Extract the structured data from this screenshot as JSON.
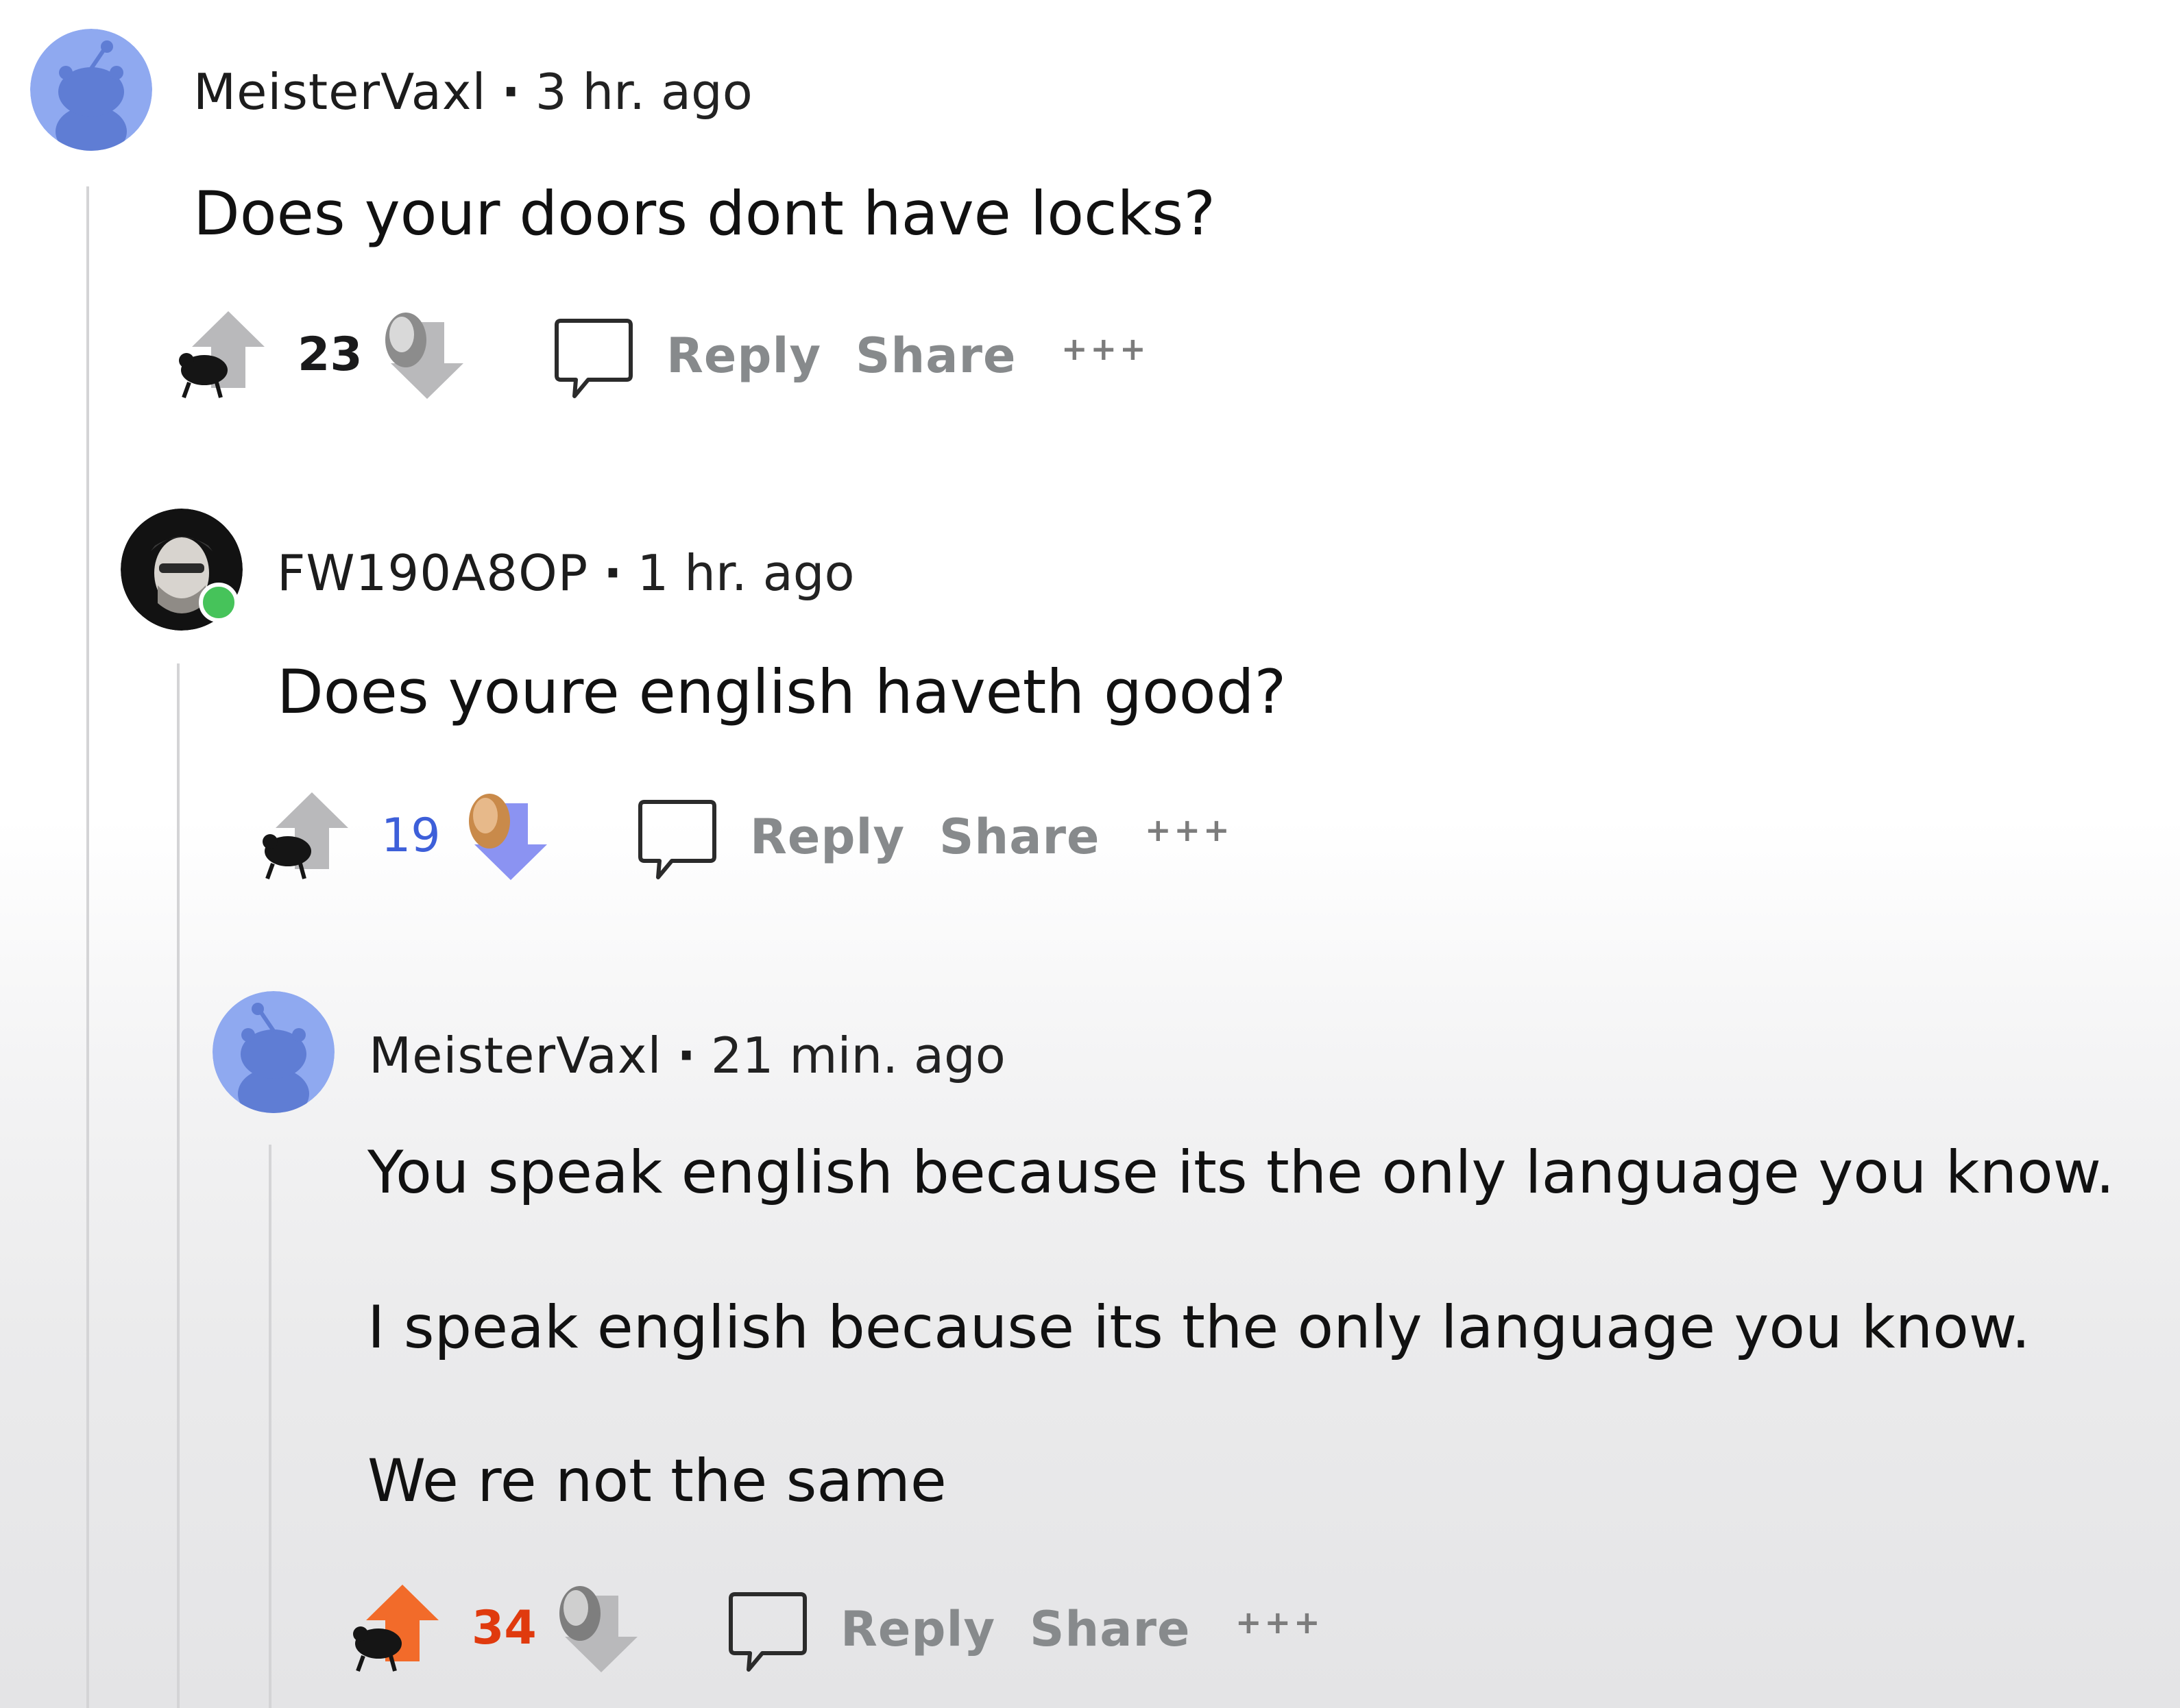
{
  "comments": [
    {
      "username": "MeisterVaxl",
      "separator": "·",
      "time": "3 hr. ago",
      "paragraphs": [
        "Does your doors dont have locks?"
      ],
      "score": "23",
      "score_color": "#1a1a1b",
      "vote_state": "none",
      "reply_label": "Reply",
      "share_label": "Share",
      "more_label": "+++",
      "avatar_icon": "snoo-avatar-icon"
    },
    {
      "username": "FW190A8OP",
      "separator": "·",
      "time": "1 hr. ago",
      "paragraphs": [
        "Does youre english haveth good?"
      ],
      "score": "19",
      "score_color": "#3d5fd9",
      "vote_state": "downvoted",
      "reply_label": "Reply",
      "share_label": "Share",
      "more_label": "+++",
      "avatar_icon": "profile-photo-avatar",
      "online_indicator": true
    },
    {
      "username": "MeisterVaxl",
      "separator": "·",
      "time": "21 min. ago",
      "paragraphs": [
        "You speak english because its the only language you know.",
        "I speak english because its the only language you know.",
        "We re not the same"
      ],
      "score": "34",
      "score_color": "#e03a0e",
      "vote_state": "upvoted",
      "reply_label": "Reply",
      "share_label": "Share",
      "more_label": "+++",
      "avatar_icon": "snoo-avatar-icon"
    }
  ],
  "colors": {
    "snoo_blue": "#8fa9f0",
    "snoo_body": "#5f7dd4",
    "upvote_orange": "#f26b2a",
    "downvote_blue": "#8b93f2",
    "neutral_arrow": "#b9b9bb",
    "online_green": "#46c35a",
    "thread_line": "#d4d4d6",
    "action_gray": "#878a8c"
  }
}
